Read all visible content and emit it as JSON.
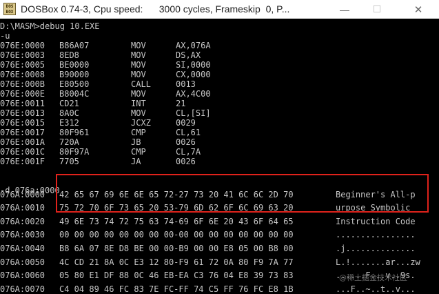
{
  "window": {
    "title": "DOSBox 0.74-3, Cpu speed:      3000 cycles, Frameskip  0, P...",
    "icon_text": "DOS BOX",
    "minimize_icon": "minimize-icon",
    "maximize_icon": "maximize-icon",
    "close_icon": "close-icon",
    "minimize_glyph": "—",
    "maximize_glyph": "☐",
    "close_glyph": "✕"
  },
  "console": {
    "prompt_command": "D:\\MASM>debug 10.EXE",
    "u_command": "-u",
    "disassembly": [
      {
        "addr": "076E:0000",
        "hex": "B86A07",
        "mnemonic": "MOV",
        "operands": "AX,076A"
      },
      {
        "addr": "076E:0003",
        "hex": "8ED8",
        "mnemonic": "MOV",
        "operands": "DS,AX"
      },
      {
        "addr": "076E:0005",
        "hex": "BE0000",
        "mnemonic": "MOV",
        "operands": "SI,0000"
      },
      {
        "addr": "076E:0008",
        "hex": "B90000",
        "mnemonic": "MOV",
        "operands": "CX,0000"
      },
      {
        "addr": "076E:000B",
        "hex": "E80500",
        "mnemonic": "CALL",
        "operands": "0013"
      },
      {
        "addr": "076E:000E",
        "hex": "B8004C",
        "mnemonic": "MOV",
        "operands": "AX,4C00"
      },
      {
        "addr": "076E:0011",
        "hex": "CD21",
        "mnemonic": "INT",
        "operands": "21"
      },
      {
        "addr": "076E:0013",
        "hex": "8A0C",
        "mnemonic": "MOV",
        "operands": "CL,[SI]"
      },
      {
        "addr": "076E:0015",
        "hex": "E312",
        "mnemonic": "JCXZ",
        "operands": "0029"
      },
      {
        "addr": "076E:0017",
        "hex": "80F961",
        "mnemonic": "CMP",
        "operands": "CL,61"
      },
      {
        "addr": "076E:001A",
        "hex": "720A",
        "mnemonic": "JB",
        "operands": "0026"
      },
      {
        "addr": "076E:001C",
        "hex": "80F97A",
        "mnemonic": "CMP",
        "operands": "CL,7A"
      },
      {
        "addr": "076E:001F",
        "hex": "7705",
        "mnemonic": "JA",
        "operands": "0026"
      }
    ],
    "d_command": "-d 076a:0000",
    "dump": [
      {
        "addr": "076A:0000",
        "hex": "42 65 67 69 6E 6E 65 72-27 73 20 41 6C 6C 2D 70",
        "ascii": "Beginner's All-p"
      },
      {
        "addr": "076A:0010",
        "hex": "75 72 70 6F 73 65 20 53-79 6D 62 6F 6C 69 63 20",
        "ascii": "urpose Symbolic"
      },
      {
        "addr": "076A:0020",
        "hex": "49 6E 73 74 72 75 63 74-69 6F 6E 20 43 6F 64 65",
        "ascii": "Instruction Code"
      },
      {
        "addr": "076A:0030",
        "hex": "00 00 00 00 00 00 00 00-00 00 00 00 00 00 00 00",
        "ascii": "................"
      },
      {
        "addr": "076A:0040",
        "hex": "B8 6A 07 8E D8 BE 00 00-B9 00 00 E8 05 00 B8 00",
        "ascii": ".j.............."
      },
      {
        "addr": "076A:0050",
        "hex": "4C CD 21 8A 0C E3 12 80-F9 61 72 0A 80 F9 7A 77",
        "ascii": "L.!.......ar...zw"
      },
      {
        "addr": "076A:0060",
        "hex": "05 80 E1 DF 88 0C 46 EB-EA C3 76 04 E8 39 73 83",
        "ascii": "......F...v..9s."
      },
      {
        "addr": "076A:0070",
        "hex": "C4 04 89 46 FC 83 7E FC-FF 74 C5 FF 76 FC E8 1B",
        "ascii": "...F..~..t..v..."
      }
    ],
    "watermark": "@稀土掘金技术社区"
  },
  "colors": {
    "console_bg": "#000000",
    "console_text": "#c8c8c8",
    "highlight_border": "#e0221b",
    "titlebar_bg": "#ffffff"
  }
}
